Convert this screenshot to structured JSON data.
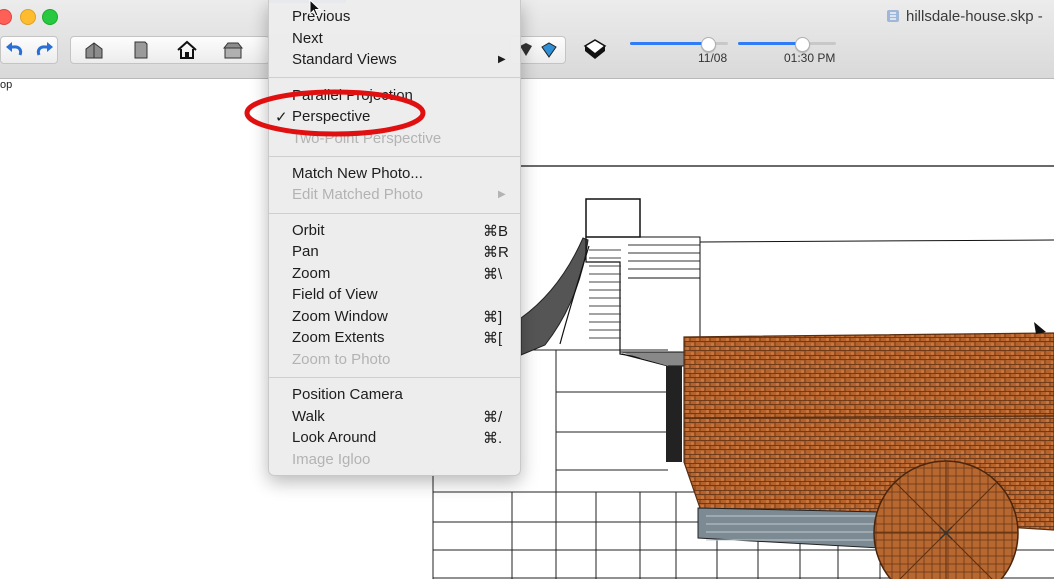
{
  "window": {
    "title": "hillsdale-house.skp -",
    "scene_tab_label": "op"
  },
  "toolbar": {
    "tools": [
      "undo-icon",
      "redo-icon",
      "perspective-iso-icon",
      "front-view-icon",
      "home-view-icon",
      "top-view-icon",
      "shadow-toggle-icon",
      "display-toggle-icon",
      "fog-icon"
    ],
    "date_value": "11/08",
    "time_value": "01:30 PM",
    "date_slider_fraction": 0.8,
    "time_slider_fraction": 0.65
  },
  "menu": {
    "items": [
      {
        "label": "Previous",
        "shortcut": "",
        "disabled": false
      },
      {
        "label": "Next",
        "shortcut": "",
        "disabled": false
      },
      {
        "label": "Standard Views",
        "shortcut": "",
        "submenu": true,
        "disabled": false
      },
      {
        "label": "Parallel Projection",
        "shortcut": "",
        "disabled": false
      },
      {
        "label": "Perspective",
        "shortcut": "",
        "checked": true,
        "disabled": false
      },
      {
        "label": "Two-Point Perspective",
        "shortcut": "",
        "disabled": true
      },
      {
        "label": "Match New Photo...",
        "shortcut": "",
        "disabled": false
      },
      {
        "label": "Edit Matched Photo",
        "shortcut": "",
        "submenu": true,
        "disabled": true
      },
      {
        "label": "Orbit",
        "shortcut": "⌘B",
        "disabled": false
      },
      {
        "label": "Pan",
        "shortcut": "⌘R",
        "disabled": false
      },
      {
        "label": "Zoom",
        "shortcut": "⌘\\",
        "disabled": false
      },
      {
        "label": "Field of View",
        "shortcut": "",
        "disabled": false
      },
      {
        "label": "Zoom Window",
        "shortcut": "⌘]",
        "disabled": false
      },
      {
        "label": "Zoom Extents",
        "shortcut": "⌘[",
        "disabled": false
      },
      {
        "label": "Zoom to Photo",
        "shortcut": "",
        "disabled": true
      },
      {
        "label": "Position Camera",
        "shortcut": "",
        "disabled": false
      },
      {
        "label": "Walk",
        "shortcut": "⌘/",
        "disabled": false
      },
      {
        "label": "Look Around",
        "shortcut": "⌘.",
        "disabled": false
      },
      {
        "label": "Image Igloo",
        "shortcut": "",
        "disabled": true
      }
    ],
    "check_glyph": "✓",
    "submenu_glyph": "▶"
  },
  "colors": {
    "accent": "#2f7cf6",
    "annotation": "#e01010",
    "roof_tile": "#b5622c"
  }
}
